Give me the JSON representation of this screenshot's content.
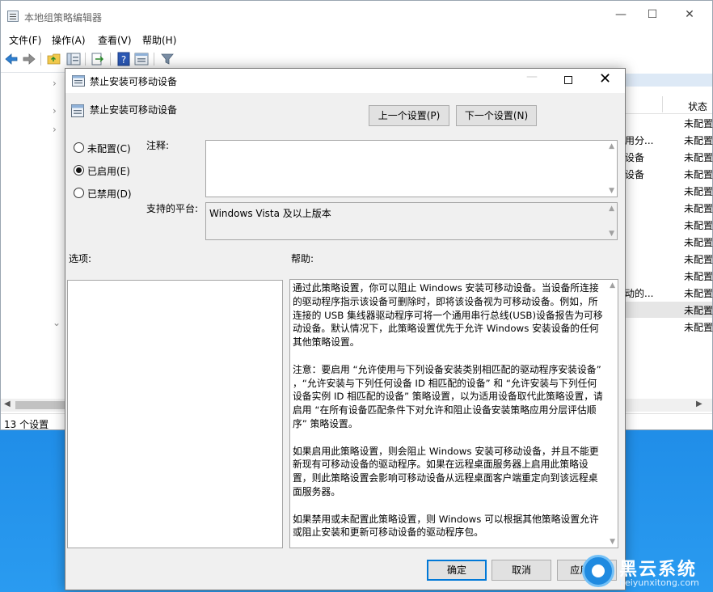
{
  "main_window": {
    "title": "本地组策略编辑器",
    "caption": {
      "minimize": "—",
      "maximize": "☐",
      "close": "✕"
    },
    "menu": {
      "file": "文件(F)",
      "action": "操作(A)",
      "view": "查看(V)",
      "help": "帮助(H)"
    },
    "tree_chevrons": [
      "›",
      "›",
      "›",
      "⌄"
    ],
    "column_status": "状态",
    "rows": [
      {
        "name": "",
        "status": "未配置"
      },
      {
        "name": "用分...",
        "status": "未配置"
      },
      {
        "name": "设备",
        "status": "未配置"
      },
      {
        "name": "设备",
        "status": "未配置"
      },
      {
        "name": "",
        "status": "未配置"
      },
      {
        "name": "",
        "status": "未配置"
      },
      {
        "name": "",
        "status": "未配置"
      },
      {
        "name": "",
        "status": "未配置"
      },
      {
        "name": "",
        "status": "未配置"
      },
      {
        "name": "",
        "status": "未配置"
      },
      {
        "name": "动的...",
        "status": "未配置"
      },
      {
        "name": "",
        "status": "未配置"
      },
      {
        "name": "",
        "status": "未配置"
      }
    ],
    "scroll_left": "◀",
    "scroll_right": "▶",
    "status_bar": "13 个设置"
  },
  "dialog": {
    "title": "禁止安装可移动设备",
    "close_glyph": "✕",
    "minimize_glyph": "—",
    "setting_title": "禁止安装可移动设备",
    "prev_button": "上一个设置(P)",
    "next_button": "下一个设置(N)",
    "radios": {
      "unconfigured": "未配置(C)",
      "enabled": "已启用(E)",
      "disabled": "已禁用(D)",
      "selected": "enabled"
    },
    "comment_label": "注释:",
    "comment_value": "",
    "platform_label": "支持的平台:",
    "platform_value": "Windows Vista 及以上版本",
    "options_label": "选项:",
    "help_label": "帮助:",
    "help_text": "通过此策略设置，你可以阻止 Windows 安装可移动设备。当设备所连接的驱动程序指示该设备可删除时，即将该设备视为可移动设备。例如，所连接的 USB 集线器驱动程序可将一个通用串行总线(USB)设备报告为可移动设备。默认情况下，此策略设置优先于允许 Windows 安装设备的任何其他策略设置。\n\n注意：要启用 “允许使用与下列设备安装类别相匹配的驱动程序安装设备” ，“允许安装与下列任何设备 ID 相匹配的设备” 和 “允许安装与下列任何设备实例 ID 相匹配的设备” 策略设置，以为适用设备取代此策略设置，请启用 “在所有设备匹配条件下对允许和阻止设备安装策略应用分层评估顺序” 策略设置。\n\n如果启用此策略设置，则会阻止 Windows 安装可移动设备，并且不能更新现有可移动设备的驱动程序。如果在远程桌面服务器上启用此策略设置，则此策略设置会影响可移动设备从远程桌面客户端重定向到该远程桌面服务器。\n\n如果禁用或未配置此策略设置，则 Windows 可以根据其他策略设置允许或阻止安装和更新可移动设备的驱动程序包。",
    "ok_button": "确定",
    "cancel_button": "取消",
    "apply_button": "应用(A)",
    "scroll_up": "▲",
    "scroll_down": "▼"
  },
  "watermark": {
    "title": "黑云系统",
    "subtitle": "heiyunxitong.com"
  },
  "colors": {
    "accent": "#0078d7",
    "desktop": "#1680e0"
  }
}
